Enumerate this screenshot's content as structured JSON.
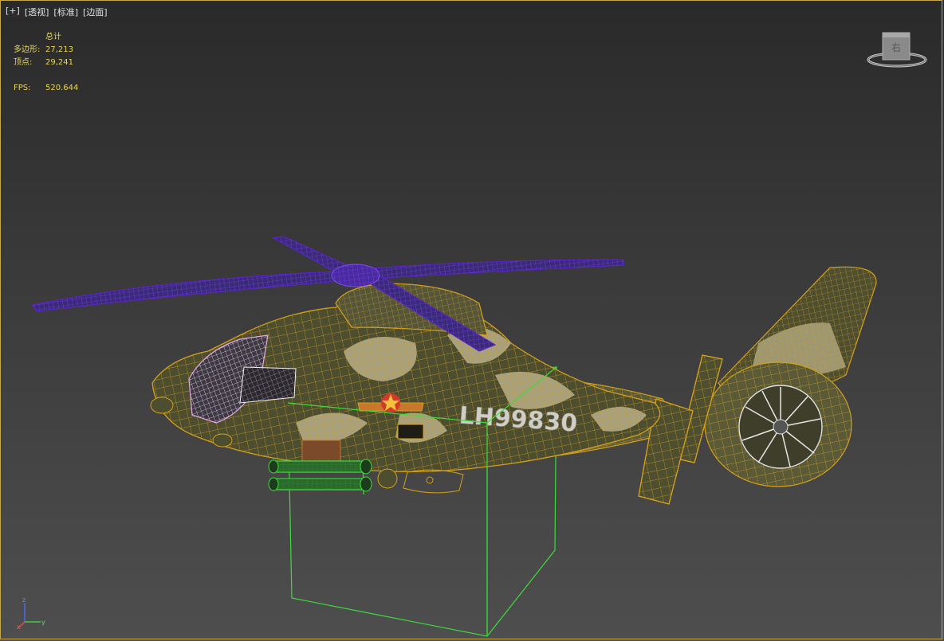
{
  "viewport": {
    "labels": [
      "[+]",
      "[透视]",
      "[标准]",
      "[边面]"
    ],
    "stats": {
      "header": "总计",
      "rows": [
        {
          "label": "多边形:",
          "value": "27,213"
        },
        {
          "label": "顶点:",
          "value": "29,241"
        }
      ],
      "fps_label": "FPS:",
      "fps_value": "520.644"
    },
    "fuselage_text": "LH99830",
    "viewcube_face": "右",
    "axis": {
      "z": "z",
      "x": "x",
      "y": "y"
    }
  },
  "colors": {
    "wire_body": "#d4a01c",
    "wire_rotor": "#5a22c8",
    "wire_selection": "#3cdc3c",
    "wire_cockpit": "#e6a8e6",
    "camo_dark": "#4a4a2e",
    "camo_light": "#b8b08a",
    "stats_text": "#e8d55a"
  }
}
